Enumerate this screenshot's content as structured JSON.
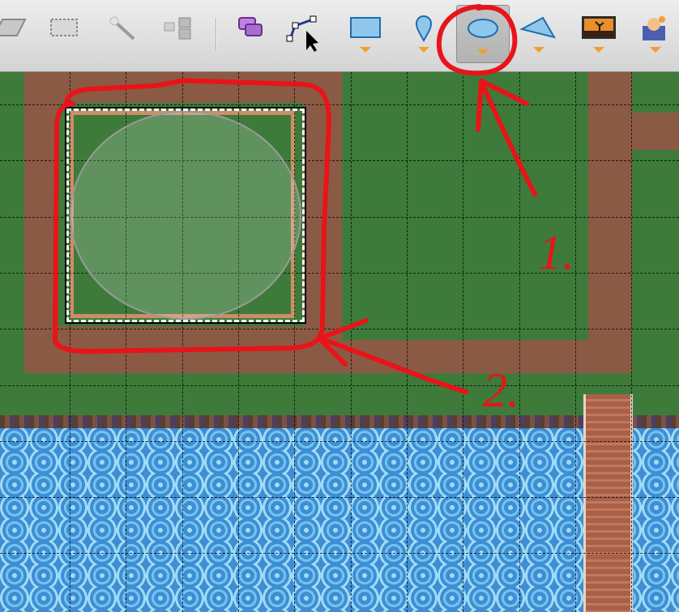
{
  "toolbar": {
    "tools": [
      {
        "name": "eraser-tool",
        "icon": "eraser-icon",
        "has_menu": false,
        "active": false
      },
      {
        "name": "rectangle-select-tool",
        "icon": "dashed-rectangle-icon",
        "has_menu": false,
        "active": false
      },
      {
        "name": "magic-wand-tool",
        "icon": "magic-wand-icon",
        "has_menu": false,
        "active": false
      },
      {
        "name": "select-same-tool",
        "icon": "select-same-tile-icon",
        "has_menu": false,
        "active": false
      },
      {
        "name": "insert-tile-tool",
        "icon": "insert-tile-icon",
        "has_menu": false,
        "active": false
      },
      {
        "name": "edit-polygons-tool",
        "icon": "edit-polygon-cursor-icon",
        "has_menu": false,
        "active": false
      },
      {
        "name": "insert-rectangle-tool",
        "icon": "rectangle-shape-icon",
        "has_menu": true,
        "active": false
      },
      {
        "name": "insert-point-tool",
        "icon": "pin-icon",
        "has_menu": true,
        "active": false
      },
      {
        "name": "insert-ellipse-tool",
        "icon": "ellipse-shape-icon",
        "has_menu": true,
        "active": true
      },
      {
        "name": "insert-polygon-tool",
        "icon": "polygon-shape-icon",
        "has_menu": true,
        "active": false
      },
      {
        "name": "insert-image-tool",
        "icon": "landscape-image-icon",
        "has_menu": true,
        "active": false
      },
      {
        "name": "insert-template-tool",
        "icon": "template-icon",
        "has_menu": true,
        "active": false
      }
    ]
  },
  "annotations": {
    "step1_label": "1.",
    "step2_label": "2.",
    "ink_color": "#e8141a"
  },
  "colors": {
    "grass": "#3e7b3a",
    "dirt": "#8b5a45",
    "water": "#3e8ed6",
    "fence": "#cc8e69"
  }
}
